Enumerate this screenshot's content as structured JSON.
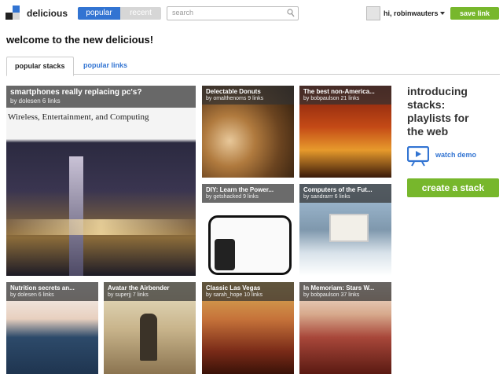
{
  "header": {
    "brand": "delicious",
    "tabs": [
      {
        "label": "popular",
        "active": true
      },
      {
        "label": "recent",
        "active": false
      }
    ],
    "search_placeholder": "search",
    "user_greeting": "hi, robinwauters",
    "save_label": "save link"
  },
  "welcome": "welcome to the new delicious!",
  "tabs": [
    {
      "label": "popular stacks",
      "active": true
    },
    {
      "label": "popular links",
      "active": false
    }
  ],
  "big_stack": {
    "title": "smartphones really replacing pc's?",
    "meta": "by dolesen 6 links",
    "image_text": "Wireless, Entertainment, and Computing"
  },
  "stacks": [
    {
      "title": "Delectable Donuts",
      "meta": "by omalthenoms 9 links"
    },
    {
      "title": "The best non-America...",
      "meta": "by bobpaulson 21 links"
    },
    {
      "title": "DIY: Learn the Power...",
      "meta": "by getshacked 9 links"
    },
    {
      "title": "Computers of the Fut...",
      "meta": "by sandrarrr 6 links"
    },
    {
      "title": "Nutrition secrets an...",
      "meta": "by dolesen 6 links"
    },
    {
      "title": "Avatar the Airbender",
      "meta": "by superjj 7 links"
    },
    {
      "title": "Classic Las Vegas",
      "meta": "by sarah_hope 10 links"
    },
    {
      "title": "In Memoriam: Stars W...",
      "meta": "by bobpaulson 37 links"
    }
  ],
  "sidebar": {
    "intro_lines": [
      "introducing",
      "stacks:",
      "playlists for",
      "the web"
    ],
    "watch_demo": "watch demo",
    "create_stack": "create a stack"
  },
  "colors": {
    "accent_blue": "#3274d2",
    "accent_green": "#77b72c"
  },
  "icons": [
    "logo-icon",
    "search-icon",
    "caret-down-icon",
    "video-demo-icon"
  ]
}
